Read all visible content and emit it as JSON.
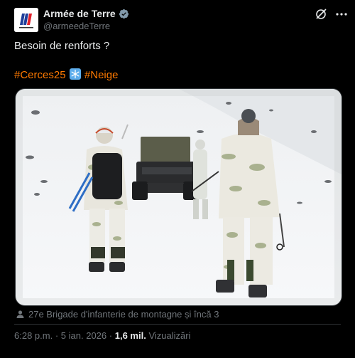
{
  "author": {
    "name": "Armée de Terre",
    "handle": "@armeedeTerre"
  },
  "tweet": {
    "text": "Besoin de renforts ?",
    "hashtag1": "#Cerces25",
    "hashtag2": "#Neige"
  },
  "tags": {
    "text": "27e Brigade d'infanterie de montagne și încă 3"
  },
  "meta": {
    "time": "6:28 p.m.",
    "separator1": "·",
    "date": "5 ian. 2026",
    "separator2": "·",
    "views_count": "1,6 mil.",
    "views_label": "Vizualizări"
  },
  "colors": {
    "hashtag": "#ff7a00",
    "verified": "#829aab",
    "background": "#000000"
  },
  "icons": [
    "verified-badge-icon",
    "grok-icon",
    "more-icon",
    "snowflake-icon",
    "person-tag-icon"
  ]
}
